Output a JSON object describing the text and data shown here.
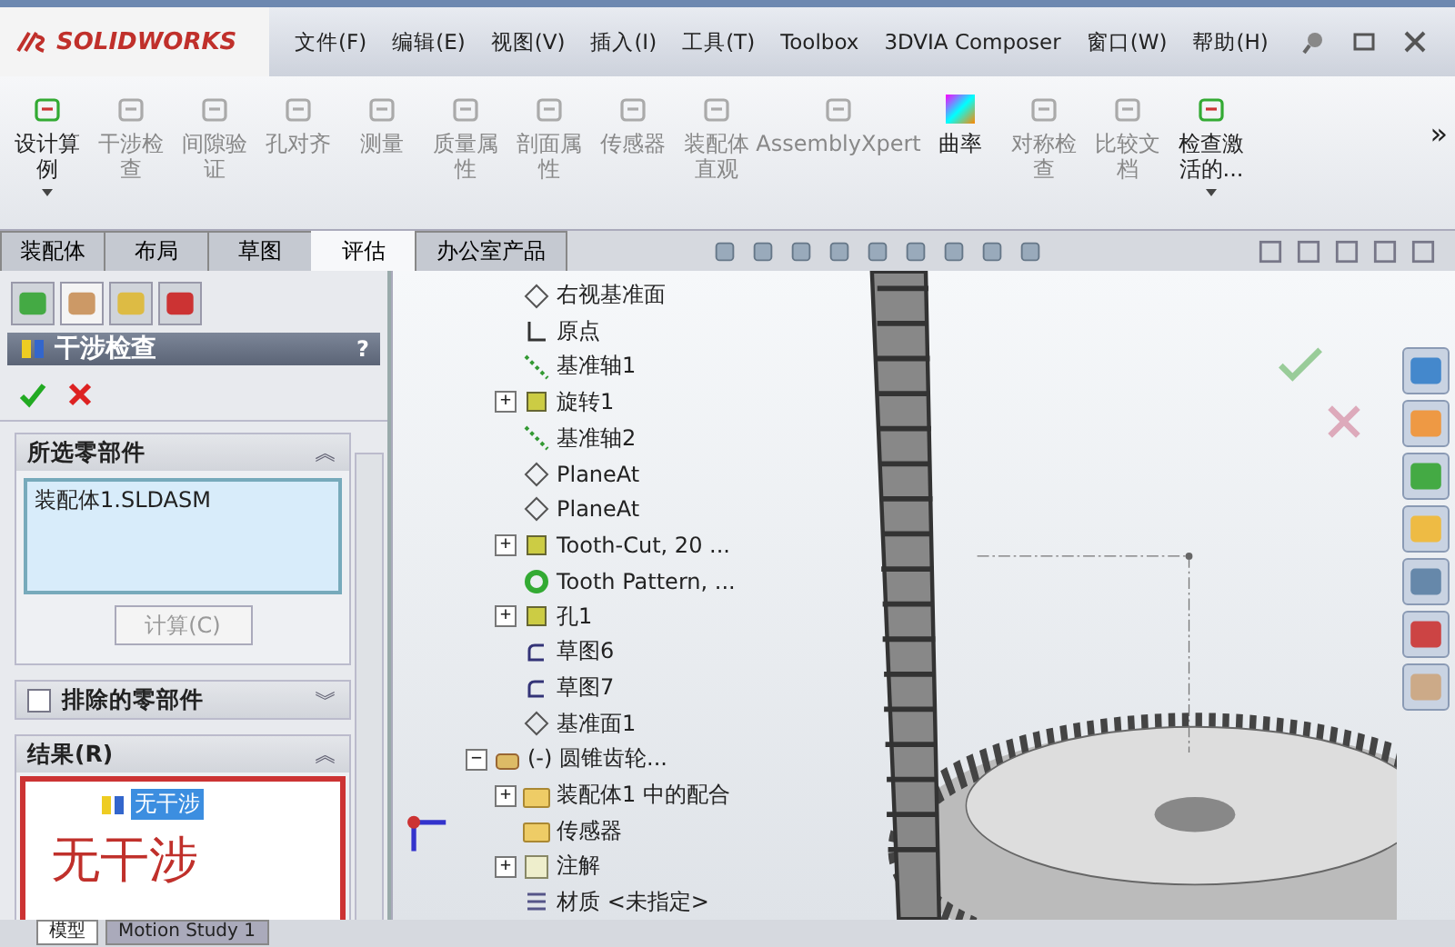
{
  "app": {
    "logo": "SOLIDWORKS"
  },
  "menu": [
    "文件(F)",
    "编辑(E)",
    "视图(V)",
    "插入(I)",
    "工具(T)",
    "Toolbox",
    "3DVIA Composer",
    "窗口(W)",
    "帮助(H)"
  ],
  "toolbar": [
    {
      "label": "设计算例",
      "kind": "dropdown",
      "disabled": false
    },
    {
      "label": "干涉检查",
      "kind": "button",
      "disabled": true
    },
    {
      "label": "间隙验证",
      "kind": "button",
      "disabled": true
    },
    {
      "label": "孔对齐",
      "kind": "button",
      "disabled": true
    },
    {
      "label": "测量",
      "kind": "button",
      "disabled": true
    },
    {
      "label": "质量属性",
      "kind": "button",
      "disabled": true
    },
    {
      "label": "剖面属性",
      "kind": "button",
      "disabled": true
    },
    {
      "label": "传感器",
      "kind": "button",
      "disabled": true
    },
    {
      "label": "装配体直观",
      "kind": "button",
      "disabled": true
    },
    {
      "label": "AssemblyXpert",
      "kind": "wide",
      "disabled": true
    },
    {
      "label": "曲率",
      "kind": "button",
      "disabled": false
    },
    {
      "label": "对称检查",
      "kind": "button",
      "disabled": true
    },
    {
      "label": "比较文档",
      "kind": "button",
      "disabled": true
    },
    {
      "label": "检查激活的...",
      "kind": "dropdown",
      "disabled": false
    }
  ],
  "overflow": "»",
  "tabs": [
    {
      "label": "装配体",
      "selected": false
    },
    {
      "label": "布局",
      "selected": false
    },
    {
      "label": "草图",
      "selected": false
    },
    {
      "label": "评估",
      "selected": true
    },
    {
      "label": "办公室产品",
      "selected": false
    }
  ],
  "panel": {
    "title": "干涉检查",
    "help": "?",
    "selected_components": {
      "header": "所选零部件",
      "chevron": "︽",
      "items": [
        "装配体1.SLDASM"
      ],
      "button": {
        "label": "计算(C)",
        "disabled": true
      }
    },
    "excluded": {
      "header": "排除的零部件",
      "chevron": "︾",
      "checked": false
    },
    "results": {
      "header": "结果(R)",
      "chevron": "︽",
      "items": [
        {
          "label": "无干涉",
          "selected": true
        }
      ],
      "annotation": "无干涉"
    }
  },
  "tree": [
    {
      "label": "右视基准面",
      "kind": "plane"
    },
    {
      "label": "原点",
      "kind": "origin"
    },
    {
      "label": "基准轴1",
      "kind": "axis"
    },
    {
      "label": "旋转1",
      "kind": "feature",
      "toggle": "+"
    },
    {
      "label": "基准轴2",
      "kind": "axis"
    },
    {
      "label": "PlaneAt",
      "kind": "plane"
    },
    {
      "label": "PlaneAt",
      "kind": "plane"
    },
    {
      "label": "Tooth-Cut, 20 ...",
      "kind": "feature",
      "toggle": "+"
    },
    {
      "label": "Tooth Pattern, ...",
      "kind": "pattern"
    },
    {
      "label": "孔1",
      "kind": "feature",
      "toggle": "+"
    },
    {
      "label": "草图6",
      "kind": "sketch"
    },
    {
      "label": "草图7",
      "kind": "sketch"
    },
    {
      "label": "基准面1",
      "kind": "plane"
    }
  ],
  "component": {
    "label": "(-) 圆锥齿轮...",
    "kind": "part",
    "toggle": "−",
    "children": [
      {
        "label": "装配体1 中的配合",
        "kind": "folder",
        "toggle": "+"
      },
      {
        "label": "传感器",
        "kind": "folder"
      },
      {
        "label": "注解",
        "kind": "annotation",
        "toggle": "+"
      },
      {
        "label": "材质 <未指定>",
        "kind": "material"
      }
    ]
  },
  "bottom_tabs": [
    {
      "label": "模型",
      "selected": true
    },
    {
      "label": "Motion Study 1",
      "selected": false
    }
  ]
}
